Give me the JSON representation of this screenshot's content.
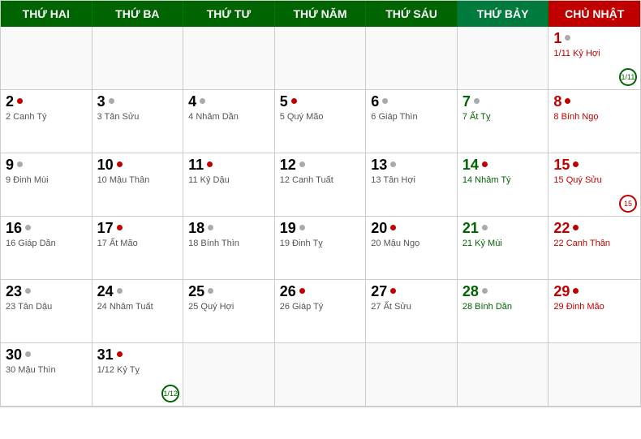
{
  "header": {
    "days": [
      {
        "label": "THỨ HAI",
        "type": "normal"
      },
      {
        "label": "THỨ BA",
        "type": "normal"
      },
      {
        "label": "THỨ TƯ",
        "type": "normal"
      },
      {
        "label": "THỨ NĂM",
        "type": "normal"
      },
      {
        "label": "THỨ SÁU",
        "type": "normal"
      },
      {
        "label": "THỨ BẢY",
        "type": "sat"
      },
      {
        "label": "CHỦ NHẬT",
        "type": "sun"
      }
    ]
  },
  "weeks": [
    [
      {
        "empty": true
      },
      {
        "empty": true
      },
      {
        "empty": true
      },
      {
        "empty": true
      },
      {
        "empty": true
      },
      {
        "empty": true
      },
      {
        "greg": "1",
        "lunar": "1/11 Kỷ Hợi",
        "dot": "gray",
        "type": "sunday",
        "circle": "1/11",
        "circleType": "green"
      }
    ],
    [
      {
        "greg": "2",
        "lunar": "2 Canh Tý",
        "dot": "red",
        "type": "normal"
      },
      {
        "greg": "3",
        "lunar": "3 Tân Sửu",
        "dot": "gray",
        "type": "normal"
      },
      {
        "greg": "4",
        "lunar": "4 Nhâm Dần",
        "dot": "gray",
        "type": "normal"
      },
      {
        "greg": "5",
        "lunar": "5 Quý Mão",
        "dot": "red",
        "type": "normal"
      },
      {
        "greg": "6",
        "lunar": "6 Giáp Thìn",
        "dot": "gray",
        "type": "normal"
      },
      {
        "greg": "7",
        "lunar": "7 Ất Tỵ",
        "dot": "gray",
        "type": "saturday"
      },
      {
        "greg": "8",
        "lunar": "8 Bính Ngọ",
        "dot": "red",
        "type": "sunday"
      }
    ],
    [
      {
        "greg": "9",
        "lunar": "9 Đinh Mùi",
        "dot": "gray",
        "type": "normal"
      },
      {
        "greg": "10",
        "lunar": "10 Mậu Thân",
        "dot": "red",
        "type": "normal"
      },
      {
        "greg": "11",
        "lunar": "11 Kỷ Dậu",
        "dot": "red",
        "type": "normal"
      },
      {
        "greg": "12",
        "lunar": "12 Canh Tuất",
        "dot": "gray",
        "type": "normal"
      },
      {
        "greg": "13",
        "lunar": "13 Tân Hợi",
        "dot": "gray",
        "type": "normal"
      },
      {
        "greg": "14",
        "lunar": "14 Nhâm Tý",
        "dot": "red",
        "type": "saturday"
      },
      {
        "greg": "15",
        "lunar": "15  Quý Sửu",
        "dot": "red",
        "type": "sunday",
        "circle": "15",
        "circleType": "red"
      }
    ],
    [
      {
        "greg": "16",
        "lunar": "16 Giáp Dần",
        "dot": "gray",
        "type": "normal"
      },
      {
        "greg": "17",
        "lunar": "17 Ất Mão",
        "dot": "red",
        "type": "normal"
      },
      {
        "greg": "18",
        "lunar": "18 Bính Thìn",
        "dot": "gray",
        "type": "normal"
      },
      {
        "greg": "19",
        "lunar": "19 Đinh Tỵ",
        "dot": "gray",
        "type": "normal"
      },
      {
        "greg": "20",
        "lunar": "20 Mậu Ngọ",
        "dot": "red",
        "type": "normal"
      },
      {
        "greg": "21",
        "lunar": "21 Kỷ Mùi",
        "dot": "gray",
        "type": "saturday"
      },
      {
        "greg": "22",
        "lunar": "22 Canh Thân",
        "dot": "red",
        "type": "sunday"
      }
    ],
    [
      {
        "greg": "23",
        "lunar": "23 Tân Dậu",
        "dot": "gray",
        "type": "normal"
      },
      {
        "greg": "24",
        "lunar": "24 Nhâm Tuất",
        "dot": "gray",
        "type": "normal"
      },
      {
        "greg": "25",
        "lunar": "25 Quý Hợi",
        "dot": "gray",
        "type": "normal"
      },
      {
        "greg": "26",
        "lunar": "26 Giáp Tý",
        "dot": "red",
        "type": "normal"
      },
      {
        "greg": "27",
        "lunar": "27 Ất Sửu",
        "dot": "red",
        "type": "normal"
      },
      {
        "greg": "28",
        "lunar": "28 Bính Dần",
        "dot": "gray",
        "type": "saturday"
      },
      {
        "greg": "29",
        "lunar": "29 Đinh Mão",
        "dot": "red",
        "type": "sunday"
      }
    ],
    [
      {
        "greg": "30",
        "lunar": "30 Mậu Thìn",
        "dot": "gray",
        "type": "normal"
      },
      {
        "greg": "31",
        "lunar": "1/12 Kỷ Tỵ",
        "dot": "red",
        "type": "normal",
        "circle": "1/12",
        "circleType": "green"
      },
      {
        "empty": true
      },
      {
        "empty": true
      },
      {
        "empty": true
      },
      {
        "empty": true
      },
      {
        "empty": true
      }
    ]
  ]
}
